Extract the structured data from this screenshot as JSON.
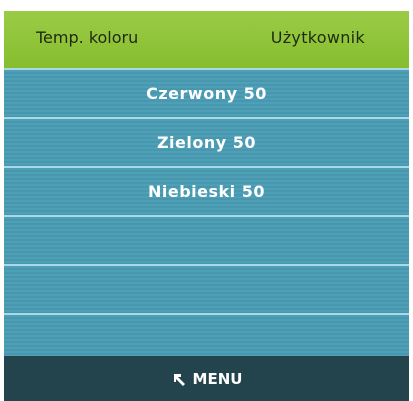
{
  "header": {
    "title": "Temp. koloru",
    "mode_value": "Użytkownik"
  },
  "menu": {
    "items": [
      {
        "label": "Czerwony 50"
      },
      {
        "label": "Zielony 50"
      },
      {
        "label": "Niebieski 50"
      },
      {
        "label": ""
      },
      {
        "label": ""
      },
      {
        "label": ""
      }
    ]
  },
  "footer": {
    "back_label": "MENU",
    "back_icon": "back-arrow-icon"
  },
  "colors": {
    "header_green": "#8cc23a",
    "list_blue": "#4b9cb3",
    "footer_dark": "#23444c",
    "row_divider": "#a9d9e6"
  }
}
